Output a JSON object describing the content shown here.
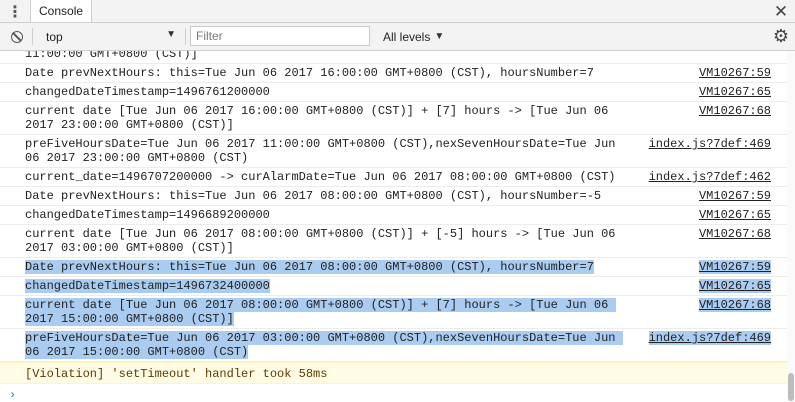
{
  "tabbar": {
    "menu_glyph": "⋮",
    "tab_label": "Console",
    "close_glyph": "✕"
  },
  "toolbar": {
    "context_value": "top",
    "filter_placeholder": "Filter",
    "levels_label": "All levels",
    "dropdown_glyph": "▼",
    "levels_glyph": "▼",
    "settings_glyph": "⚙"
  },
  "messages": [
    {
      "text": "11:00:00 GMT+0800 (CST)]",
      "source": "",
      "selected": false
    },
    {
      "text": "Date prevNextHours: this=Tue Jun 06 2017 16:00:00 GMT+0800 (CST), hoursNumber=7",
      "source": "VM10267:59",
      "selected": false
    },
    {
      "text": "changedDateTimestamp=1496761200000",
      "source": "VM10267:65",
      "selected": false
    },
    {
      "text": "current date [Tue Jun 06 2017 16:00:00 GMT+0800 (CST)] + [7] hours -> [Tue Jun 06 2017 23:00:00 GMT+0800 (CST)]",
      "source": "VM10267:68",
      "selected": false
    },
    {
      "text": "preFiveHoursDate=Tue Jun 06 2017 11:00:00 GMT+0800 (CST),nexSevenHoursDate=Tue Jun 06 2017 23:00:00 GMT+0800 (CST)",
      "source": "index.js?7def:469",
      "selected": false
    },
    {
      "text": "current_date=1496707200000 -> curAlarmDate=Tue Jun 06 2017 08:00:00 GMT+0800 (CST)",
      "source": "index.js?7def:462",
      "selected": false
    },
    {
      "text": "Date prevNextHours: this=Tue Jun 06 2017 08:00:00 GMT+0800 (CST), hoursNumber=-5",
      "source": "VM10267:59",
      "selected": false
    },
    {
      "text": "changedDateTimestamp=1496689200000",
      "source": "VM10267:65",
      "selected": false
    },
    {
      "text": "current date [Tue Jun 06 2017 08:00:00 GMT+0800 (CST)] + [-5] hours -> [Tue Jun 06 2017 03:00:00 GMT+0800 (CST)]",
      "source": "VM10267:68",
      "selected": false
    },
    {
      "text": "Date prevNextHours: this=Tue Jun 06 2017 08:00:00 GMT+0800 (CST), hoursNumber=7",
      "source": "VM10267:59",
      "selected": true
    },
    {
      "text": "changedDateTimestamp=1496732400000",
      "source": "VM10267:65",
      "selected": true
    },
    {
      "text": "current date [Tue Jun 06 2017 08:00:00 GMT+0800 (CST)] + [7] hours -> [Tue Jun 06 2017 15:00:00 GMT+0800 (CST)]",
      "source": "VM10267:68",
      "selected": true
    },
    {
      "text": "preFiveHoursDate=Tue Jun 06 2017 03:00:00 GMT+0800 (CST),nexSevenHoursDate=Tue Jun 06 2017 15:00:00 GMT+0800 (CST)",
      "source": "index.js?7def:469",
      "selected": true
    }
  ],
  "violation": {
    "text": "[Violation] 'setTimeout' handler took 58ms"
  },
  "prompt": {
    "glyph": "›"
  },
  "colors": {
    "selection": "#aaccf0",
    "warning_bg": "#fffbe5",
    "prompt": "#3478f6"
  }
}
